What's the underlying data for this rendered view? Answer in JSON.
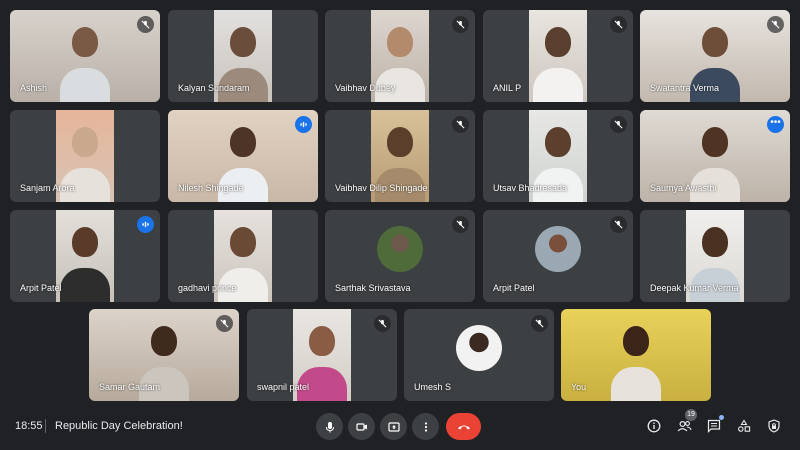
{
  "participants": [
    {
      "name": "Ashish",
      "muted": true
    },
    {
      "name": "Kalyan Sundaram",
      "muted": false
    },
    {
      "name": "Vaibhav Dubey",
      "muted": true
    },
    {
      "name": "ANIL P",
      "muted": true
    },
    {
      "name": "Swatantra Verma",
      "muted": true
    },
    {
      "name": "Sanjam Arora",
      "muted": false
    },
    {
      "name": "Nilesh Shingade",
      "speaking": true
    },
    {
      "name": "Vaibhav Dilip Shingade",
      "muted": true
    },
    {
      "name": "Utsav Bhadresada",
      "muted": true
    },
    {
      "name": "Saumya Awasthi",
      "active": true
    },
    {
      "name": "Arpit Patel",
      "speaking": true
    },
    {
      "name": "gadhavi prince",
      "muted": false
    },
    {
      "name": "Sarthak Srivastava",
      "muted": true
    },
    {
      "name": "Arpit Patel",
      "muted": true
    },
    {
      "name": "Deepak Kumar Verma",
      "muted": false
    },
    {
      "name": "Samar Gautam",
      "muted": true
    },
    {
      "name": "swapnil patel",
      "muted": true
    },
    {
      "name": "Umesh S",
      "muted": true
    },
    {
      "name": "You",
      "muted": false
    }
  ],
  "bottom_bar": {
    "time": "18:55",
    "meeting_title": "Republic Day Celebration!",
    "people_count": "19"
  },
  "colors": {
    "background": "#202124",
    "tile": "#3c4043",
    "hangup": "#ea4335",
    "accent": "#1a73e8"
  }
}
